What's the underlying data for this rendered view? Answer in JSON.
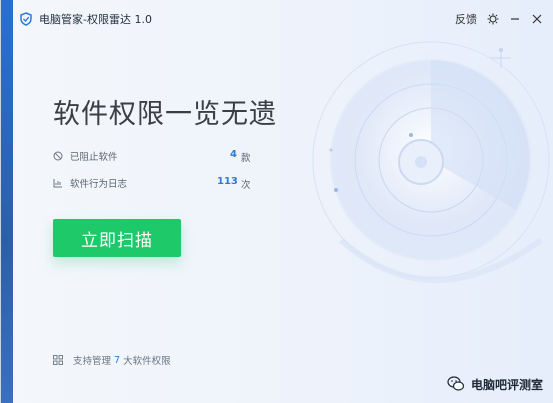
{
  "window": {
    "title": "电脑管家-权限雷达 1.0",
    "feedback_label": "反馈"
  },
  "main": {
    "headline": "软件权限一览无遗",
    "stats": [
      {
        "label": "已阻止软件",
        "value": "4",
        "unit": "款",
        "icon": "block-icon"
      },
      {
        "label": "软件行为日志",
        "value": "113",
        "unit": "次",
        "icon": "log-icon"
      }
    ],
    "scan_button": "立即扫描"
  },
  "footer": {
    "prefix": "支持管理",
    "count": "7",
    "suffix": "大软件权限"
  },
  "watermark": {
    "text": "电脑吧评测室"
  },
  "colors": {
    "accent_green": "#1ec96a",
    "accent_blue": "#2b7bd8",
    "sidebar_blue": "#2a6fd0"
  }
}
